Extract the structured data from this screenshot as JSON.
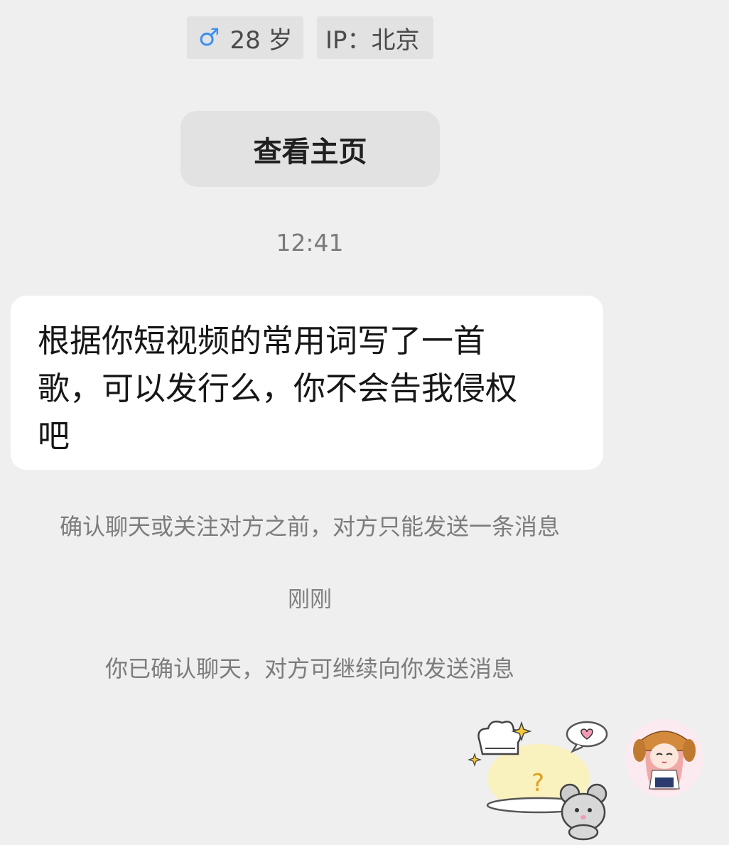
{
  "profile": {
    "gender_icon": "male-icon",
    "gender_symbol": "♂",
    "age": "28 岁",
    "ip": "IP：北京",
    "view_profile_label": "查看主页"
  },
  "chat": {
    "timestamp_1": "12:41",
    "message": "根据你短视频的常用词写了一首\n歌，可以发行么，你不会告我侵权\n吧",
    "notice_1": "确认聊天或关注对方之前，对方只能发送一条消息",
    "timestamp_2": "刚刚",
    "notice_2": "你已确认聊天，对方可继续向你发送消息",
    "sticker_text": "?"
  },
  "colors": {
    "background": "#efefef",
    "bubble": "#ffffff",
    "tag": "#e2e2e2",
    "male_icon": "#3a8ff0"
  }
}
